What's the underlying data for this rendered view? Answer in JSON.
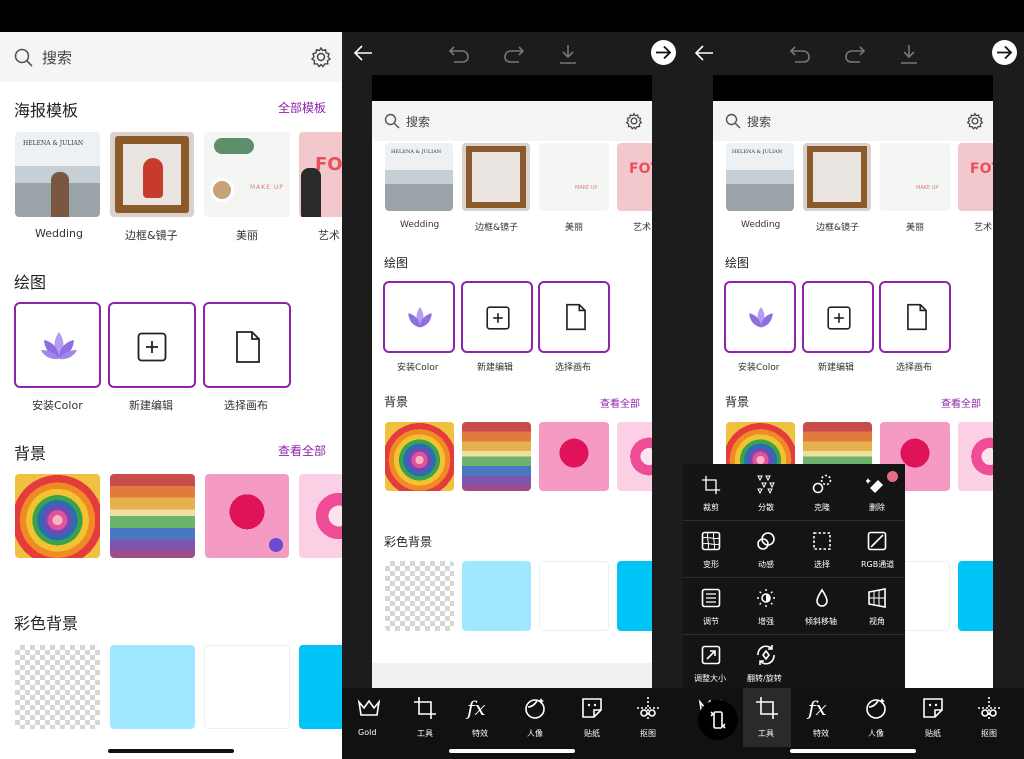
{
  "panel1": {
    "search": {
      "placeholder": "搜索"
    },
    "poster": {
      "title": "海报模板",
      "all_link": "全部模板",
      "items": [
        {
          "label": "Wedding",
          "thumb_text": "HELENA & JULIAN"
        },
        {
          "label": "边框&镜子"
        },
        {
          "label": "美丽",
          "thumb_text": "MAKE UP"
        },
        {
          "label": "艺术",
          "thumb_text": "FOT"
        }
      ]
    },
    "draw": {
      "title": "绘图",
      "items": [
        {
          "label": "安装Color"
        },
        {
          "label": "新建编辑"
        },
        {
          "label": "选择画布"
        }
      ]
    },
    "background": {
      "title": "背景",
      "all_link": "查看全部"
    },
    "color_bg": {
      "title": "彩色背景"
    }
  },
  "panel2": {
    "search": {
      "placeholder": "搜索"
    },
    "poster": {
      "items": [
        {
          "label": "Wedding",
          "thumb_text": "HELENA & JULIAN"
        },
        {
          "label": "边框&镜子"
        },
        {
          "label": "美丽",
          "thumb_text": "MAKE UP"
        },
        {
          "label": "艺术",
          "thumb_text": "FOT"
        }
      ]
    },
    "draw": {
      "title": "绘图",
      "items": [
        {
          "label": "安装Color"
        },
        {
          "label": "新建编辑"
        },
        {
          "label": "选择画布"
        }
      ]
    },
    "background": {
      "title": "背景",
      "all_link": "查看全部"
    },
    "color_bg": {
      "title": "彩色背景"
    },
    "bottom_bar": [
      {
        "label": "Gold",
        "icon": "crown-icon"
      },
      {
        "label": "工具",
        "icon": "crop-icon"
      },
      {
        "label": "特效",
        "icon": "fx-icon"
      },
      {
        "label": "人像",
        "icon": "face-icon"
      },
      {
        "label": "贴纸",
        "icon": "sticker-icon"
      },
      {
        "label": "抠图",
        "icon": "cutout-icon"
      }
    ]
  },
  "panel3": {
    "search": {
      "placeholder": "搜索"
    },
    "poster": {
      "items": [
        {
          "label": "Wedding",
          "thumb_text": "HELENA & JULIAN"
        },
        {
          "label": "边框&镜子"
        },
        {
          "label": "美丽",
          "thumb_text": "MAKE UP"
        },
        {
          "label": "艺术",
          "thumb_text": "FOT"
        }
      ]
    },
    "draw": {
      "title": "绘图",
      "items": [
        {
          "label": "安装Color"
        },
        {
          "label": "新建编辑"
        },
        {
          "label": "选择画布"
        }
      ]
    },
    "background": {
      "title": "背景",
      "all_link": "查看全部"
    },
    "tools_menu": [
      {
        "label": "裁剪",
        "icon": "crop-icon"
      },
      {
        "label": "分散",
        "icon": "disperse-icon"
      },
      {
        "label": "克隆",
        "icon": "clone-icon"
      },
      {
        "label": "删除",
        "icon": "eraser-icon"
      },
      {
        "label": "变形",
        "icon": "warp-icon"
      },
      {
        "label": "动感",
        "icon": "motion-icon"
      },
      {
        "label": "选择",
        "icon": "select-icon"
      },
      {
        "label": "RGB通道",
        "icon": "rgb-icon"
      },
      {
        "label": "调节",
        "icon": "adjust-icon"
      },
      {
        "label": "增强",
        "icon": "enhance-icon"
      },
      {
        "label": "倾斜移轴",
        "icon": "tiltshift-icon"
      },
      {
        "label": "视角",
        "icon": "perspective-icon"
      },
      {
        "label": "调整大小",
        "icon": "resize-icon"
      },
      {
        "label": "翻转/旋转",
        "icon": "flip-rotate-icon"
      }
    ],
    "bottom_bar": [
      {
        "label": "工具",
        "icon": "crop-icon"
      },
      {
        "label": "特效",
        "icon": "fx-icon"
      },
      {
        "label": "人像",
        "icon": "face-icon"
      },
      {
        "label": "贴纸",
        "icon": "sticker-icon"
      },
      {
        "label": "抠图",
        "icon": "cutout-icon"
      }
    ]
  },
  "colors": {
    "accent": "#8e24aa",
    "dark": "#1a1a1a",
    "light_blue": "#a0e8ff",
    "cyan": "#00c4f5"
  }
}
